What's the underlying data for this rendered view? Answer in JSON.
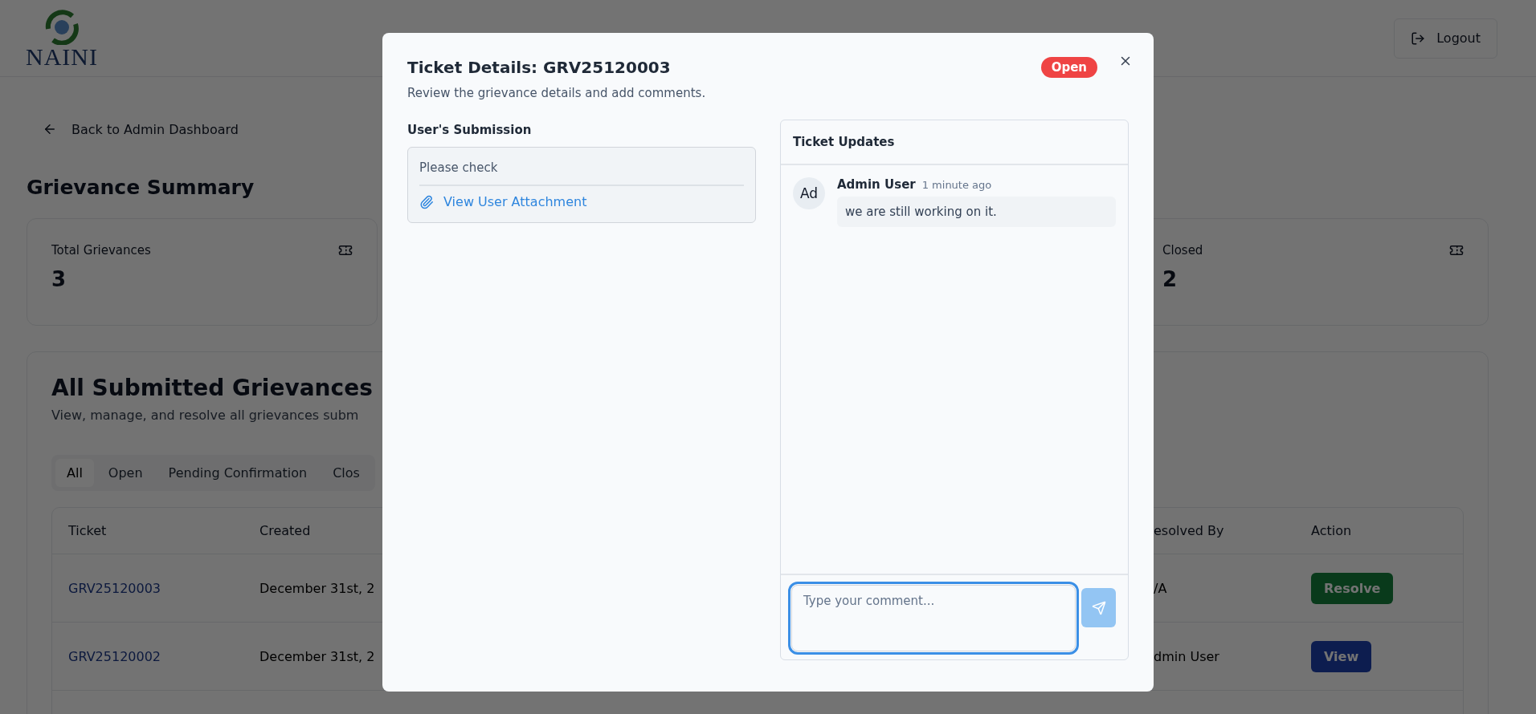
{
  "header": {
    "logo_text": "NAINI",
    "logout_label": "Logout"
  },
  "page": {
    "back_link": "Back to Admin Dashboard",
    "summary_title": "Grievance Summary",
    "stats": [
      {
        "label": "Total Grievances",
        "value": "3"
      },
      {
        "label": "Closed",
        "value": "2"
      }
    ],
    "list": {
      "title": "All Submitted Grievances",
      "subtitle": "View, manage, and resolve all grievances subm",
      "tabs": [
        {
          "label": "All",
          "selected": true
        },
        {
          "label": "Open",
          "selected": false
        },
        {
          "label": "Pending Confirmation",
          "selected": false
        },
        {
          "label": "Clos",
          "selected": false
        }
      ],
      "columns": [
        "Ticket",
        "Created",
        "esolved By",
        "Action"
      ],
      "rows": [
        {
          "ticket": "GRV25120003",
          "created": "December 31st, 2",
          "resolved_by": "/A",
          "action": {
            "label": "Resolve",
            "kind": "resolve"
          }
        },
        {
          "ticket": "GRV25120002",
          "created": "December 31st, 2",
          "resolved_by": "dmin User",
          "action": {
            "label": "View",
            "kind": "view"
          }
        }
      ]
    }
  },
  "dialog": {
    "title": "Ticket Details: GRV25120003",
    "status": {
      "label": "Open",
      "kind": "open"
    },
    "description": "Review the grievance details and add comments.",
    "submission": {
      "heading": "User's Submission",
      "text": "Please check",
      "attachment_link": "View User Attachment"
    },
    "updates": {
      "heading": "Ticket Updates",
      "comments": [
        {
          "initials": "Ad",
          "author": "Admin User",
          "time": "1 minute ago",
          "text": "we are still working on it."
        }
      ],
      "comment_field": {
        "placeholder": "Type your comment...",
        "focused": true
      },
      "send_button": {
        "disabled": true
      }
    }
  }
}
